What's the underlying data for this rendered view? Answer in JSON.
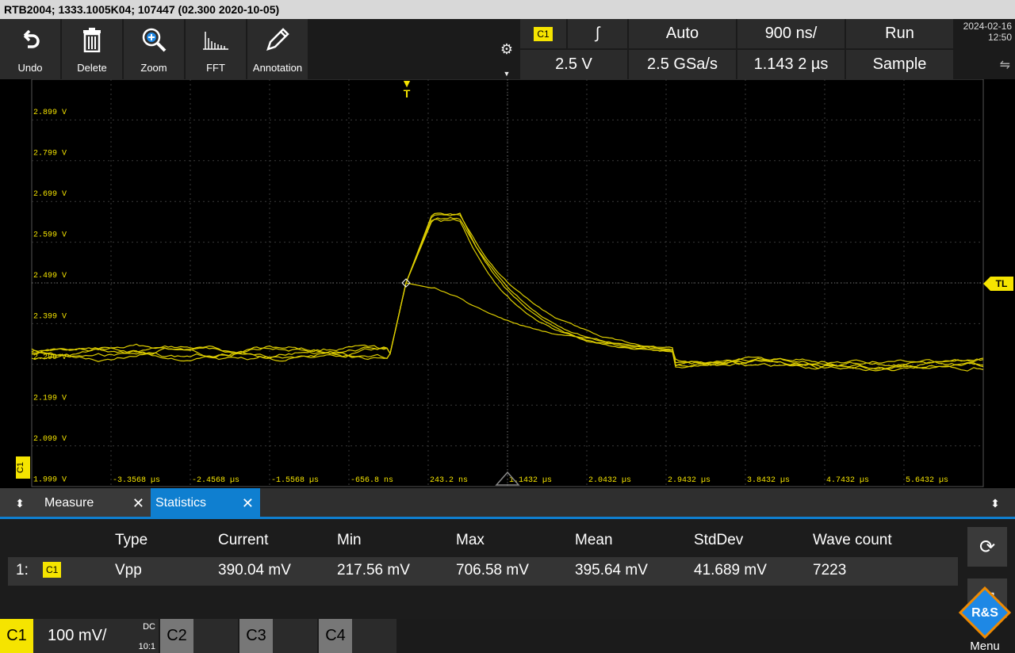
{
  "title": "RTB2004; 1333.1005K04; 107447 (02.300 2020-10-05)",
  "toolbar": {
    "undo": "Undo",
    "delete": "Delete",
    "zoom": "Zoom",
    "fft": "FFT",
    "annotation": "Annotation"
  },
  "header": {
    "channel": "C1",
    "trigger_slope": "∫",
    "trigger_mode": "Auto",
    "timebase": "900 ns/",
    "run_state": "Run",
    "trigger_level": "2.5 V",
    "sample_rate": "2.5 GSa/s",
    "position": "1.143 2 µs",
    "acq_mode": "Sample",
    "date": "2024-02-16",
    "time": "12:50"
  },
  "grid": {
    "y_labels": [
      "2.899 V",
      "2.799 V",
      "2.699 V",
      "2.599 V",
      "2.499 V",
      "2.399 V",
      "2.299 V",
      "2.199 V",
      "2.099 V",
      "1.999 V"
    ],
    "x_labels": [
      "-3.3568 µs",
      "-2.4568 µs",
      "-1.5568 µs",
      "-656.8 ns",
      "243.2 ns",
      "1.1432 µs",
      "2.0432 µs",
      "2.9432 µs",
      "3.8432 µs",
      "4.7432 µs",
      "5.6432 µs"
    ],
    "trigger_marker": "T",
    "trigger_level_marker": "TL",
    "channel_marker": "C1"
  },
  "tabs": {
    "measure": "Measure",
    "statistics": "Statistics"
  },
  "stats": {
    "headers": [
      "Type",
      "Current",
      "Min",
      "Max",
      "Mean",
      "StdDev",
      "Wave count"
    ],
    "row": {
      "index": "1:",
      "channel": "C1",
      "type": "Vpp",
      "current": "390.04 mV",
      "min": "217.56 mV",
      "max": "706.58 mV",
      "mean": "395.64 mV",
      "stddev": "41.689 mV",
      "wave_count": "7223"
    }
  },
  "bottom": {
    "ch1": "C1",
    "ch1_scale": "100 mV/",
    "ch1_coupling": "DC",
    "ch1_probe": "10:1",
    "ch2": "C2",
    "ch3": "C3",
    "ch4": "C4",
    "menu": "Menu"
  },
  "colors": {
    "trace": "#f5e400",
    "accent": "#0f7fd0"
  }
}
